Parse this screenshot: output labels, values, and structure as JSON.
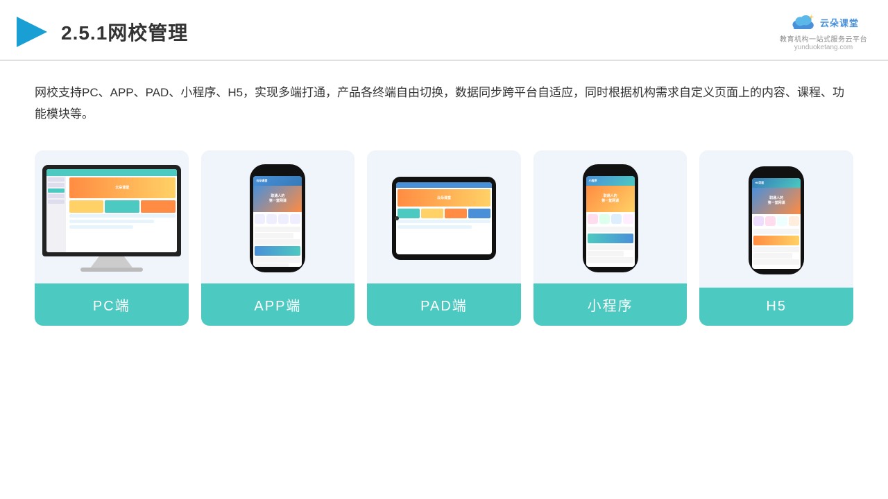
{
  "header": {
    "title": "2.5.1网校管理",
    "logo": {
      "name": "云朵课堂",
      "url": "yunduoketang.com",
      "subtitle": "教育机构一站式服务云平台"
    }
  },
  "description": "网校支持PC、APP、PAD、小程序、H5，实现多端打通，产品各终端自由切换，数据同步跨平台自适应，同时根据机构需求自定义页面上的内容、课程、功能模块等。",
  "cards": [
    {
      "id": "pc",
      "label": "PC端",
      "type": "pc"
    },
    {
      "id": "app",
      "label": "APP端",
      "type": "phone"
    },
    {
      "id": "pad",
      "label": "PAD端",
      "type": "pad"
    },
    {
      "id": "miniprogram",
      "label": "小程序",
      "type": "phone"
    },
    {
      "id": "h5",
      "label": "H5",
      "type": "phone"
    }
  ],
  "colors": {
    "teal": "#4cc9c0",
    "blue": "#4a90d9",
    "bg_card": "#f0f4fb",
    "accent_orange": "#ff8c42"
  }
}
